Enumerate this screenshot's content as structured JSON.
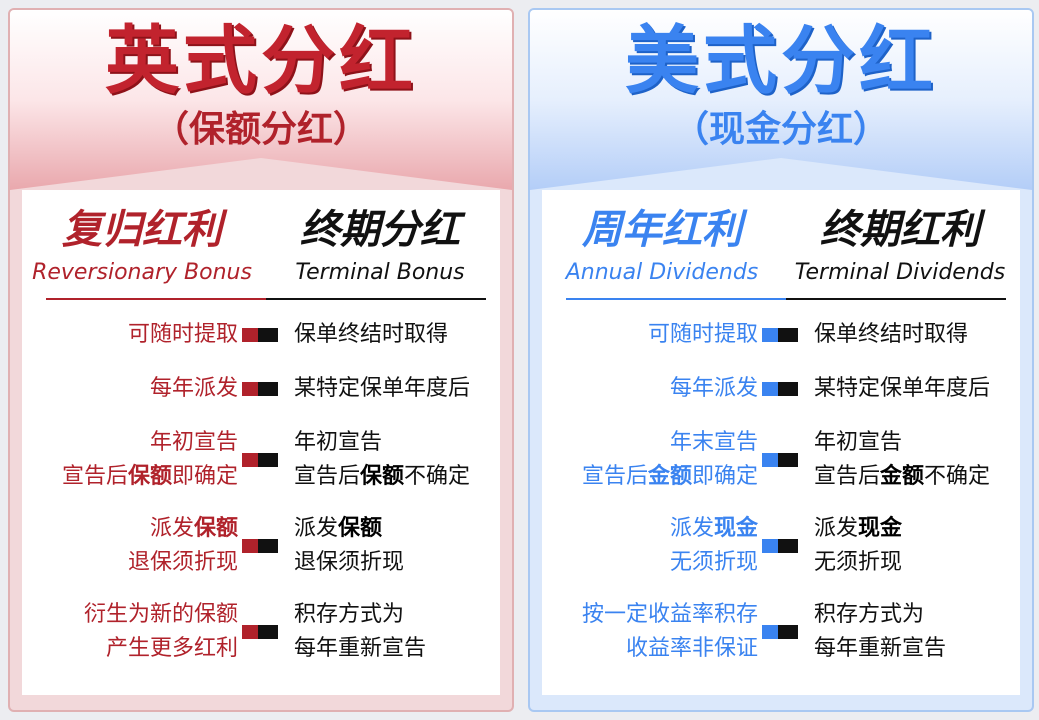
{
  "uk": {
    "title": "英式分红",
    "subtitle": "（保额分红）",
    "left_head": {
      "zh": "复归红利",
      "en": "Reversionary Bonus"
    },
    "right_head": {
      "zh": "终期分红",
      "en": "Terminal Bonus"
    },
    "rows": [
      {
        "left": [
          "可随时提取"
        ],
        "right": [
          "保单终结时取得"
        ]
      },
      {
        "left": [
          "每年派发"
        ],
        "right": [
          "某特定保单年度后"
        ]
      },
      {
        "left": [
          "年初宣告",
          "宣告后保额即确定"
        ],
        "right": [
          "年初宣告",
          "宣告后保额不确定"
        ]
      },
      {
        "left": [
          "派发保额",
          "退保须折现"
        ],
        "right": [
          "派发保额",
          "退保须折现"
        ]
      },
      {
        "left": [
          "衍生为新的保额",
          "产生更多红利"
        ],
        "right": [
          "积存方式为",
          "每年重新宣告"
        ]
      }
    ],
    "bold_words": {
      "l3": "保额",
      "r3": "保额",
      "l4": "保额",
      "r4": "保额"
    }
  },
  "us": {
    "title": "美式分红",
    "subtitle": "（现金分红）",
    "left_head": {
      "zh": "周年红利",
      "en": "Annual Dividends"
    },
    "right_head": {
      "zh": "终期红利",
      "en": "Terminal Dividends"
    },
    "rows": [
      {
        "left": [
          "可随时提取"
        ],
        "right": [
          "保单终结时取得"
        ]
      },
      {
        "left": [
          "每年派发"
        ],
        "right": [
          "某特定保单年度后"
        ]
      },
      {
        "left": [
          "年末宣告",
          "宣告后金额即确定"
        ],
        "right": [
          "年初宣告",
          "宣告后金额不确定"
        ]
      },
      {
        "left": [
          "派发现金",
          "无须折现"
        ],
        "right": [
          "派发现金",
          "无须折现"
        ]
      },
      {
        "left": [
          "按一定收益率积存",
          "收益率非保证"
        ],
        "right": [
          "积存方式为",
          "每年重新宣告"
        ]
      }
    ]
  },
  "colors": {
    "uk_accent": "#b0222b",
    "us_accent": "#3a83f0",
    "text": "#111111"
  }
}
